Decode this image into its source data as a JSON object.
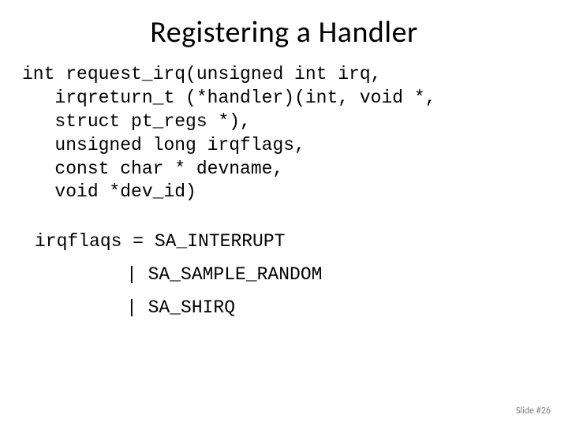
{
  "title": "Registering a Handler",
  "code": {
    "l1": "int request_irq(unsigned int irq,",
    "l2": "irqreturn_t (*handler)(int, void *,",
    "l3": "struct pt_regs *),",
    "l4": "unsigned long irqflags,",
    "l5": "const char * devname,",
    "l6": "void *dev_id)"
  },
  "irqflags_assign": "irqflaqs = SA_INTERRUPT",
  "flag1": "| SA_SAMPLE_RANDOM",
  "flag2": "| SA_SHIRQ",
  "footer": "Slide #26"
}
